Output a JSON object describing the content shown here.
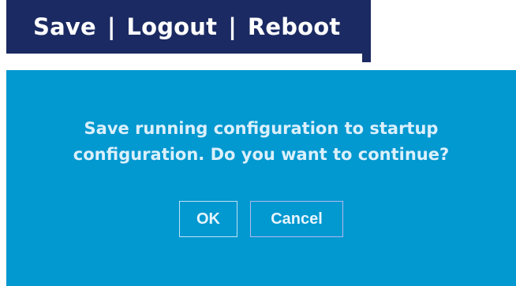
{
  "nav": {
    "save_label": "Save",
    "logout_label": "Logout",
    "reboot_label": "Reboot",
    "separator": "|"
  },
  "dialog": {
    "message_line1": "Save running configuration to startup",
    "message_line2": "configuration. Do you want to continue?",
    "ok_label": "OK",
    "cancel_label": "Cancel"
  },
  "colors": {
    "nav_background": "#1b2a62",
    "dialog_background": "#0298d0",
    "text": "#ffffff"
  }
}
